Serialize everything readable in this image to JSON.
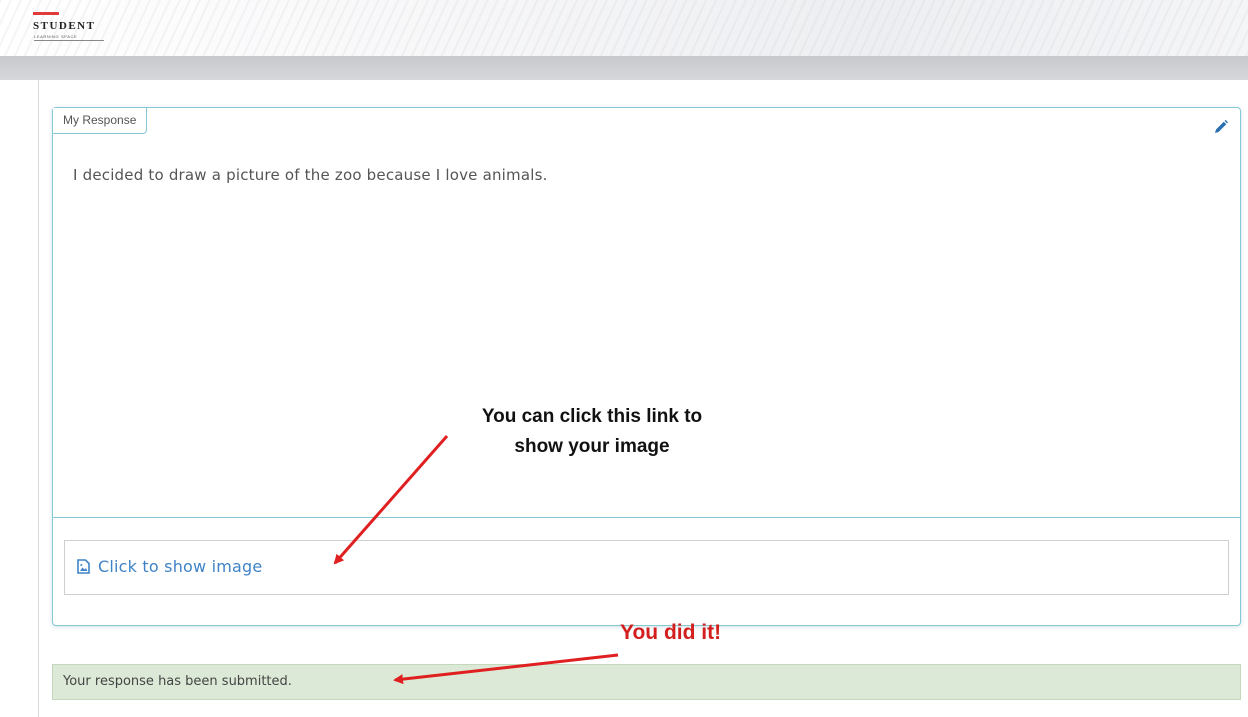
{
  "header": {
    "logo_main": "STUDENT",
    "logo_sub": "LEARNING SPACE"
  },
  "response": {
    "tab_label": "My Response",
    "text": "I decided to draw a picture of the zoo because I love animals.",
    "edit_icon": "pencil-icon",
    "attachment": {
      "icon": "image-file-icon",
      "label": "Click to show image"
    }
  },
  "status": {
    "message": "Your response has been submitted."
  },
  "annotations": {
    "link_hint_line1": "You can click this link to",
    "link_hint_line2": "show your image",
    "success": "You did it!"
  },
  "colors": {
    "card_border": "#86c9d6",
    "link": "#3f83c7",
    "status_bg": "#dbe9d6",
    "annotation_arrow": "#e02020",
    "success_text": "#d31e1e"
  }
}
